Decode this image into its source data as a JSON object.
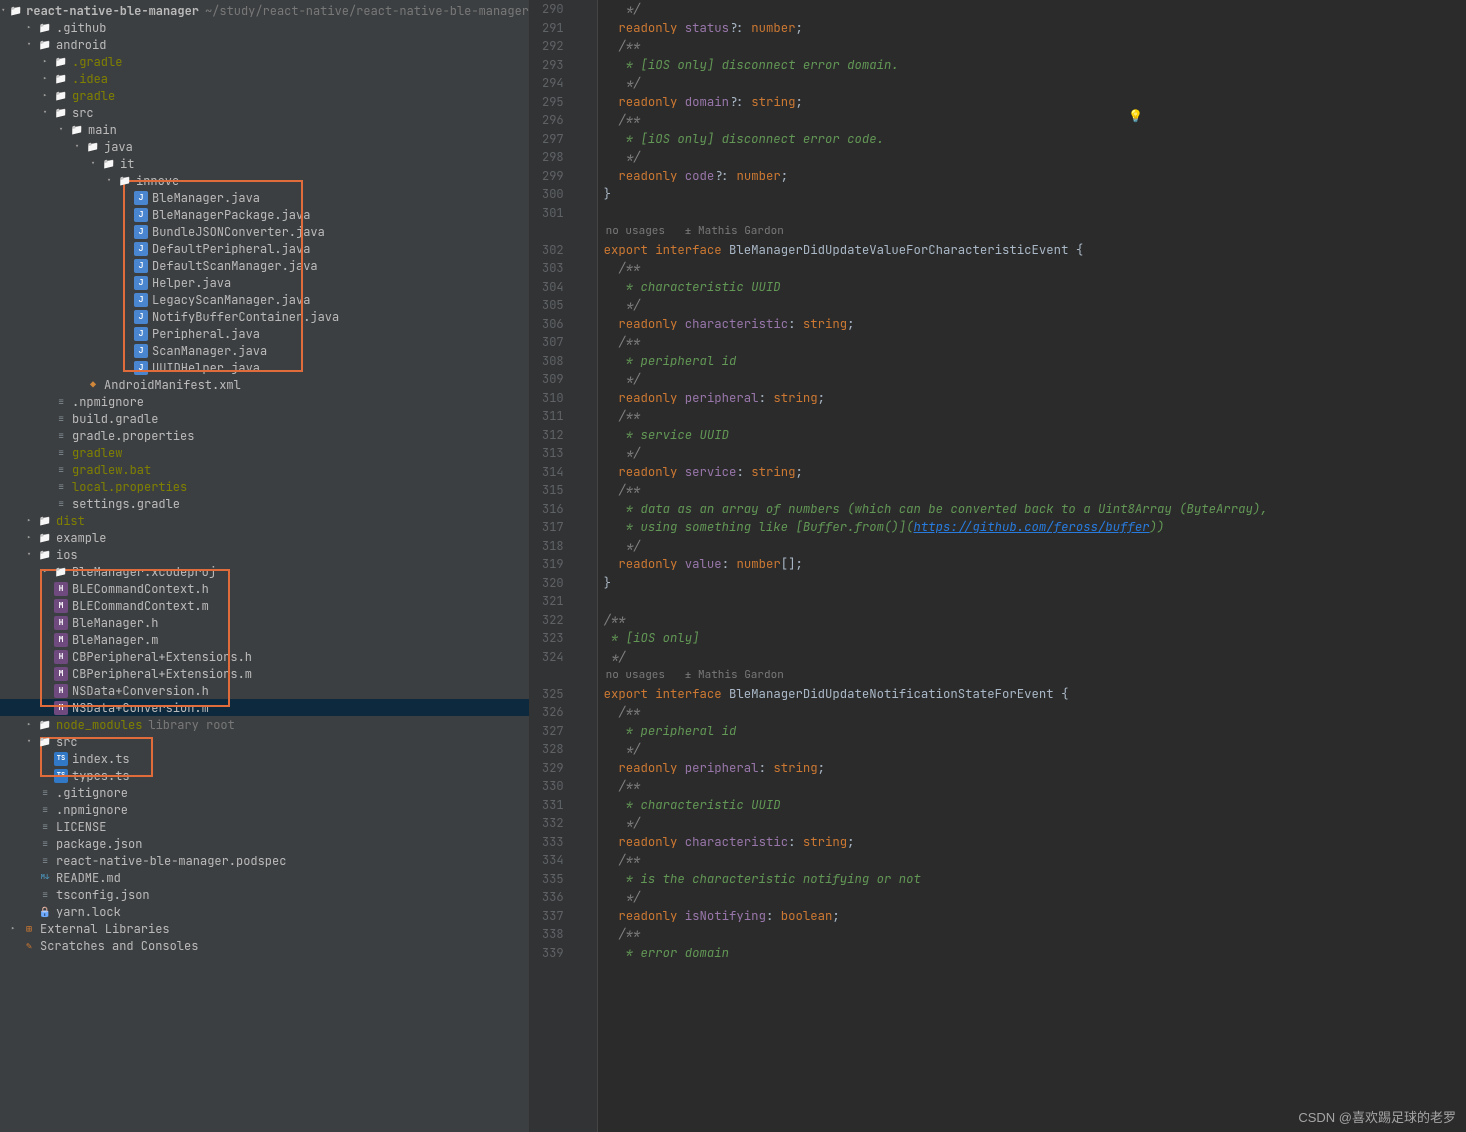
{
  "project": {
    "name": "react-native-ble-manager",
    "path": "~/study/react-native/react-native-ble-manager"
  },
  "tree": [
    {
      "d": 0,
      "c": "down",
      "i": "folder",
      "l": "react-native-ble-manager",
      "bold": true,
      "hint": "~/study/react-native/react-native-ble-manager"
    },
    {
      "d": 1,
      "c": "right",
      "i": "folder",
      "l": ".github"
    },
    {
      "d": 1,
      "c": "down",
      "i": "folder",
      "l": "android"
    },
    {
      "d": 2,
      "c": "right",
      "i": "folder",
      "l": ".gradle",
      "olive": true
    },
    {
      "d": 2,
      "c": "right",
      "i": "folder",
      "l": ".idea",
      "olive": true
    },
    {
      "d": 2,
      "c": "right",
      "i": "folder",
      "l": "gradle",
      "olive": true
    },
    {
      "d": 2,
      "c": "down",
      "i": "folder",
      "l": "src"
    },
    {
      "d": 3,
      "c": "down",
      "i": "folder",
      "l": "main"
    },
    {
      "d": 4,
      "c": "down",
      "i": "folder",
      "l": "java"
    },
    {
      "d": 5,
      "c": "down",
      "i": "folder",
      "l": "it"
    },
    {
      "d": 6,
      "c": "down",
      "i": "folder",
      "l": "innove"
    },
    {
      "d": 7,
      "c": "",
      "i": "java",
      "l": "BleManager.java"
    },
    {
      "d": 7,
      "c": "",
      "i": "java",
      "l": "BleManagerPackage.java"
    },
    {
      "d": 7,
      "c": "",
      "i": "java",
      "l": "BundleJSONConverter.java"
    },
    {
      "d": 7,
      "c": "",
      "i": "java",
      "l": "DefaultPeripheral.java"
    },
    {
      "d": 7,
      "c": "",
      "i": "java",
      "l": "DefaultScanManager.java"
    },
    {
      "d": 7,
      "c": "",
      "i": "java",
      "l": "Helper.java"
    },
    {
      "d": 7,
      "c": "",
      "i": "java",
      "l": "LegacyScanManager.java"
    },
    {
      "d": 7,
      "c": "",
      "i": "java",
      "l": "NotifyBufferContainer.java"
    },
    {
      "d": 7,
      "c": "",
      "i": "java",
      "l": "Peripheral.java"
    },
    {
      "d": 7,
      "c": "",
      "i": "java",
      "l": "ScanManager.java"
    },
    {
      "d": 7,
      "c": "",
      "i": "java",
      "l": "UUIDHelper.java"
    },
    {
      "d": 4,
      "c": "",
      "i": "xml",
      "l": "AndroidManifest.xml"
    },
    {
      "d": 2,
      "c": "",
      "i": "file",
      "l": ".npmignore"
    },
    {
      "d": 2,
      "c": "",
      "i": "file",
      "l": "build.gradle"
    },
    {
      "d": 2,
      "c": "",
      "i": "file",
      "l": "gradle.properties"
    },
    {
      "d": 2,
      "c": "",
      "i": "file",
      "l": "gradlew",
      "olive": true
    },
    {
      "d": 2,
      "c": "",
      "i": "file",
      "l": "gradlew.bat",
      "olive": true
    },
    {
      "d": 2,
      "c": "",
      "i": "file",
      "l": "local.properties",
      "olive": true
    },
    {
      "d": 2,
      "c": "",
      "i": "file",
      "l": "settings.gradle"
    },
    {
      "d": 1,
      "c": "right",
      "i": "folder",
      "l": "dist",
      "olive": true
    },
    {
      "d": 1,
      "c": "right",
      "i": "folder",
      "l": "example"
    },
    {
      "d": 1,
      "c": "down",
      "i": "folder",
      "l": "ios"
    },
    {
      "d": 2,
      "c": "right",
      "i": "folder",
      "l": "BleManager.xcodeproj"
    },
    {
      "d": 2,
      "c": "",
      "i": "h",
      "l": "BLECommandContext.h"
    },
    {
      "d": 2,
      "c": "",
      "i": "m",
      "l": "BLECommandContext.m"
    },
    {
      "d": 2,
      "c": "",
      "i": "h",
      "l": "BleManager.h"
    },
    {
      "d": 2,
      "c": "",
      "i": "m",
      "l": "BleManager.m"
    },
    {
      "d": 2,
      "c": "",
      "i": "h",
      "l": "CBPeripheral+Extensions.h"
    },
    {
      "d": 2,
      "c": "",
      "i": "m",
      "l": "CBPeripheral+Extensions.m"
    },
    {
      "d": 2,
      "c": "",
      "i": "h",
      "l": "NSData+Conversion.h"
    },
    {
      "d": 2,
      "c": "",
      "i": "m",
      "l": "NSData+Conversion.m",
      "sel": true
    },
    {
      "d": 1,
      "c": "right",
      "i": "folder",
      "l": "node_modules",
      "olive": true,
      "hint": "library root"
    },
    {
      "d": 1,
      "c": "down",
      "i": "folder",
      "l": "src"
    },
    {
      "d": 2,
      "c": "",
      "i": "ts",
      "l": "index.ts"
    },
    {
      "d": 2,
      "c": "",
      "i": "ts",
      "l": "types.ts"
    },
    {
      "d": 1,
      "c": "",
      "i": "file",
      "l": ".gitignore"
    },
    {
      "d": 1,
      "c": "",
      "i": "file",
      "l": ".npmignore"
    },
    {
      "d": 1,
      "c": "",
      "i": "file",
      "l": "LICENSE"
    },
    {
      "d": 1,
      "c": "",
      "i": "file",
      "l": "package.json"
    },
    {
      "d": 1,
      "c": "",
      "i": "file",
      "l": "react-native-ble-manager.podspec"
    },
    {
      "d": 1,
      "c": "",
      "i": "md",
      "l": "README.md"
    },
    {
      "d": 1,
      "c": "",
      "i": "file",
      "l": "tsconfig.json"
    },
    {
      "d": 1,
      "c": "",
      "i": "lock",
      "l": "yarn.lock"
    },
    {
      "d": 0,
      "c": "right",
      "i": "lib",
      "l": "External Libraries"
    },
    {
      "d": 0,
      "c": "",
      "i": "scratch",
      "l": "Scratches and Consoles"
    }
  ],
  "code_start_line": 290,
  "code_lines": [
    {
      "t": "comm",
      "txt": "   */"
    },
    {
      "t": "code",
      "segs": [
        [
          "kw",
          "  readonly "
        ],
        [
          "prop",
          "status"
        ],
        [
          "typ",
          "?: "
        ],
        [
          "kw",
          "number"
        ],
        [
          "typ",
          ";"
        ]
      ]
    },
    {
      "t": "comm",
      "txt": "  /**"
    },
    {
      "t": "commstar",
      "txt": "   * [iOS only] disconnect error domain."
    },
    {
      "t": "comm",
      "txt": "   */"
    },
    {
      "t": "code",
      "segs": [
        [
          "kw",
          "  readonly "
        ],
        [
          "prop",
          "domain"
        ],
        [
          "typ",
          "?: "
        ],
        [
          "kw",
          "string"
        ],
        [
          "typ",
          ";"
        ]
      ]
    },
    {
      "t": "comm",
      "txt": "  /**"
    },
    {
      "t": "commstar",
      "txt": "   * [iOS only] disconnect error code."
    },
    {
      "t": "comm",
      "txt": "   */"
    },
    {
      "t": "code",
      "segs": [
        [
          "kw",
          "  readonly "
        ],
        [
          "prop",
          "code"
        ],
        [
          "typ",
          "?: "
        ],
        [
          "kw",
          "number"
        ],
        [
          "typ",
          ";"
        ]
      ]
    },
    {
      "t": "code",
      "segs": [
        [
          "typ",
          "}"
        ]
      ]
    },
    {
      "t": "blank"
    },
    {
      "t": "usage",
      "txt": "no usages   ± Mathis Gardon"
    },
    {
      "t": "code",
      "segs": [
        [
          "kw",
          "export interface "
        ],
        [
          "typ",
          "BleManagerDidUpdateValueForCharacteristicEvent {"
        ]
      ]
    },
    {
      "t": "comm",
      "txt": "  /**"
    },
    {
      "t": "commstar",
      "txt": "   * characteristic UUID"
    },
    {
      "t": "comm",
      "txt": "   */"
    },
    {
      "t": "code",
      "segs": [
        [
          "kw",
          "  readonly "
        ],
        [
          "prop",
          "characteristic"
        ],
        [
          "typ",
          ": "
        ],
        [
          "kw",
          "string"
        ],
        [
          "typ",
          ";"
        ]
      ]
    },
    {
      "t": "comm",
      "txt": "  /**"
    },
    {
      "t": "commstar",
      "txt": "   * peripheral id"
    },
    {
      "t": "comm",
      "txt": "   */"
    },
    {
      "t": "code",
      "segs": [
        [
          "kw",
          "  readonly "
        ],
        [
          "prop",
          "peripheral"
        ],
        [
          "typ",
          ": "
        ],
        [
          "kw",
          "string"
        ],
        [
          "typ",
          ";"
        ]
      ]
    },
    {
      "t": "comm",
      "txt": "  /**"
    },
    {
      "t": "commstar",
      "txt": "   * service UUID"
    },
    {
      "t": "comm",
      "txt": "   */"
    },
    {
      "t": "code",
      "segs": [
        [
          "kw",
          "  readonly "
        ],
        [
          "prop",
          "service"
        ],
        [
          "typ",
          ": "
        ],
        [
          "kw",
          "string"
        ],
        [
          "typ",
          ";"
        ]
      ]
    },
    {
      "t": "comm",
      "txt": "  /**"
    },
    {
      "t": "commstar",
      "txt": "   * data as an array of numbers (which can be converted back to a Uint8Array (ByteArray),"
    },
    {
      "t": "link",
      "txt": "   * using something like [Buffer.from()](https://github.com/feross/buffer))"
    },
    {
      "t": "comm",
      "txt": "   */"
    },
    {
      "t": "code",
      "segs": [
        [
          "kw",
          "  readonly "
        ],
        [
          "prop",
          "value"
        ],
        [
          "typ",
          ": "
        ],
        [
          "kw",
          "number"
        ],
        [
          "typ",
          "[];"
        ]
      ]
    },
    {
      "t": "code",
      "segs": [
        [
          "typ",
          "}"
        ]
      ]
    },
    {
      "t": "blank"
    },
    {
      "t": "comm",
      "txt": "/**"
    },
    {
      "t": "commstar",
      "txt": " * [iOS only]"
    },
    {
      "t": "comm",
      "txt": " */"
    },
    {
      "t": "usage",
      "txt": "no usages   ± Mathis Gardon"
    },
    {
      "t": "code",
      "segs": [
        [
          "kw",
          "export interface "
        ],
        [
          "typ",
          "BleManagerDidUpdateNotificationStateForEvent {"
        ]
      ]
    },
    {
      "t": "comm",
      "txt": "  /**"
    },
    {
      "t": "commstar",
      "txt": "   * peripheral id"
    },
    {
      "t": "comm",
      "txt": "   */"
    },
    {
      "t": "code",
      "segs": [
        [
          "kw",
          "  readonly "
        ],
        [
          "prop",
          "peripheral"
        ],
        [
          "typ",
          ": "
        ],
        [
          "kw",
          "string"
        ],
        [
          "typ",
          ";"
        ]
      ]
    },
    {
      "t": "comm",
      "txt": "  /**"
    },
    {
      "t": "commstar",
      "txt": "   * characteristic UUID"
    },
    {
      "t": "comm",
      "txt": "   */"
    },
    {
      "t": "code",
      "segs": [
        [
          "kw",
          "  readonly "
        ],
        [
          "prop",
          "characteristic"
        ],
        [
          "typ",
          ": "
        ],
        [
          "kw",
          "string"
        ],
        [
          "typ",
          ";"
        ]
      ]
    },
    {
      "t": "comm",
      "txt": "  /**"
    },
    {
      "t": "commstar",
      "txt": "   * is the characteristic notifying or not"
    },
    {
      "t": "comm",
      "txt": "   */"
    },
    {
      "t": "code",
      "segs": [
        [
          "kw",
          "  readonly "
        ],
        [
          "prop",
          "isNotifying"
        ],
        [
          "typ",
          ": "
        ],
        [
          "kw",
          "boolean"
        ],
        [
          "typ",
          ";"
        ]
      ]
    },
    {
      "t": "comm",
      "txt": "  /**"
    },
    {
      "t": "commstar",
      "txt": "   * error domain"
    }
  ],
  "watermark": "CSDN @喜欢踢足球的老罗"
}
